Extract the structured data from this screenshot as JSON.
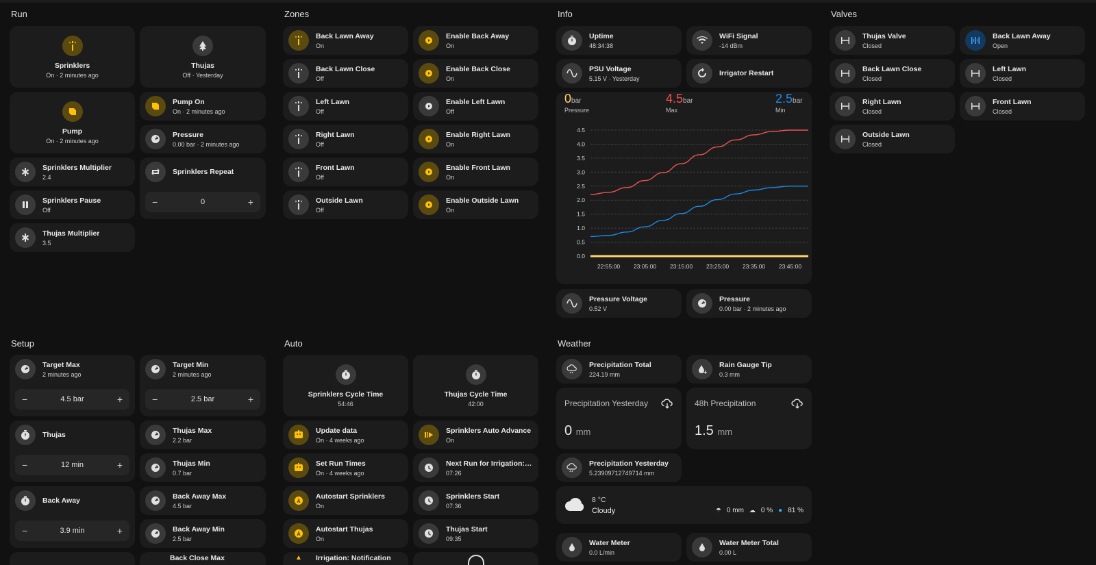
{
  "sections": {
    "run": "Run",
    "zones": "Zones",
    "info": "Info",
    "valves": "Valves",
    "setup": "Setup",
    "auto": "Auto",
    "weather": "Weather"
  },
  "run": {
    "sprinklers": {
      "name": "Sprinklers",
      "state": "On · 2 minutes ago"
    },
    "thujas": {
      "name": "Thujas",
      "state": "Off · Yesterday"
    },
    "pump": {
      "name": "Pump",
      "state": "On · 2 minutes ago"
    },
    "pump_on": {
      "name": "Pump On",
      "state": "On · 2 minutes ago"
    },
    "pressure": {
      "name": "Pressure",
      "state": "0.00 bar · 2 minutes ago"
    },
    "sprinklers_multiplier": {
      "name": "Sprinklers Multiplier",
      "state": "2.4"
    },
    "sprinklers_repeat": {
      "name": "Sprinklers Repeat",
      "value": "0",
      "minus": "−",
      "plus": "+"
    },
    "sprinklers_pause": {
      "name": "Sprinklers Pause",
      "state": "Off"
    },
    "thujas_multiplier": {
      "name": "Thujas Multiplier",
      "state": "3.5"
    }
  },
  "zones": [
    {
      "name": "Back Lawn Away",
      "state": "On",
      "enable": "Enable Back Away",
      "enable_state": "On"
    },
    {
      "name": "Back Lawn Close",
      "state": "Off",
      "enable": "Enable Back Close",
      "enable_state": "On"
    },
    {
      "name": "Left Lawn",
      "state": "Off",
      "enable": "Enable Left Lawn",
      "enable_state": "Off"
    },
    {
      "name": "Right Lawn",
      "state": "Off",
      "enable": "Enable Right Lawn",
      "enable_state": "On"
    },
    {
      "name": "Front Lawn",
      "state": "Off",
      "enable": "Enable Front Lawn",
      "enable_state": "On"
    },
    {
      "name": "Outside Lawn",
      "state": "Off",
      "enable": "Enable Outside Lawn",
      "enable_state": "On"
    }
  ],
  "info": {
    "uptime": {
      "name": "Uptime",
      "state": "48:34:38"
    },
    "wifi": {
      "name": "WiFi Signal",
      "state": "-14 dBm"
    },
    "psu": {
      "name": "PSU Voltage",
      "state": "5.15 V · Yesterday"
    },
    "restart": {
      "name": "Irrigator Restart"
    },
    "pressure_voltage": {
      "name": "Pressure Voltage",
      "state": "0.52 V"
    },
    "pressure": {
      "name": "Pressure",
      "state": "0.00 bar · 2 minutes ago"
    }
  },
  "chart_data": {
    "type": "line",
    "stats": [
      {
        "value": "0",
        "unit": "bar",
        "label": "Pressure",
        "color": "#ffd36b"
      },
      {
        "value": "4.5",
        "unit": "bar",
        "label": "Max",
        "color": "#ef5350"
      },
      {
        "value": "2.5",
        "unit": "bar",
        "label": "Min",
        "color": "#1e88e5"
      }
    ],
    "x": [
      "22:50:00",
      "22:55:00",
      "23:00:00",
      "23:05:00",
      "23:10:00",
      "23:15:00",
      "23:20:00",
      "23:25:00",
      "23:30:00",
      "23:35:00",
      "23:40:00",
      "23:45:00",
      "23:50:00"
    ],
    "x_ticks": [
      "22:55:00",
      "23:05:00",
      "23:15:00",
      "23:25:00",
      "23:35:00",
      "23:45:00"
    ],
    "y_ticks": [
      "0.0",
      "0.5",
      "1.0",
      "1.5",
      "2.0",
      "2.5",
      "3.0",
      "3.5",
      "4.0",
      "4.5"
    ],
    "ylim": [
      0,
      4.5
    ],
    "series": [
      {
        "name": "Max",
        "color": "#ef5350",
        "values": [
          2.2,
          2.28,
          2.45,
          2.7,
          2.98,
          3.3,
          3.62,
          3.9,
          4.15,
          4.33,
          4.45,
          4.5,
          4.5
        ]
      },
      {
        "name": "Min",
        "color": "#1e88e5",
        "values": [
          0.7,
          0.74,
          0.86,
          1.05,
          1.28,
          1.52,
          1.78,
          2.02,
          2.22,
          2.36,
          2.45,
          2.5,
          2.5
        ]
      },
      {
        "name": "Pressure",
        "color": "#ffd36b",
        "values": [
          0,
          0,
          0,
          0,
          0,
          0,
          0,
          0,
          0,
          0,
          0,
          0,
          0
        ]
      }
    ],
    "grid": true
  },
  "valves": [
    {
      "name": "Thujas Valve",
      "state": "Closed",
      "open": false
    },
    {
      "name": "Back Lawn Away",
      "state": "Open",
      "open": true
    },
    {
      "name": "Back Lawn Close",
      "state": "Closed",
      "open": false
    },
    {
      "name": "Left Lawn",
      "state": "Closed",
      "open": false
    },
    {
      "name": "Right Lawn",
      "state": "Closed",
      "open": false
    },
    {
      "name": "Front Lawn",
      "state": "Closed",
      "open": false
    },
    {
      "name": "Outside Lawn",
      "state": "Closed",
      "open": false
    }
  ],
  "setup": {
    "target_max": {
      "name": "Target Max",
      "state": "2 minutes ago",
      "value": "4.5 bar"
    },
    "target_min": {
      "name": "Target Min",
      "state": "2 minutes ago",
      "value": "2.5 bar"
    },
    "thujas": {
      "name": "Thujas",
      "value": "12 min"
    },
    "thujas_max": {
      "name": "Thujas Max",
      "state": "2.2 bar"
    },
    "thujas_min": {
      "name": "Thujas Min",
      "state": "0.7 bar"
    },
    "back_away": {
      "name": "Back Away",
      "value": "3.9 min"
    },
    "back_away_max": {
      "name": "Back Away Max",
      "state": "4.5 bar"
    },
    "back_away_min": {
      "name": "Back Away Min",
      "state": "2.5 bar"
    },
    "back_close_max": {
      "name": "Back Close Max"
    },
    "minus": "−",
    "plus": "+"
  },
  "auto": {
    "sprinklers_cycle": {
      "name": "Sprinklers Cycle Time",
      "state": "54:46"
    },
    "thujas_cycle": {
      "name": "Thujas Cycle Time",
      "state": "42:00"
    },
    "update_data": {
      "name": "Update data",
      "state": "On · 4 weeks ago"
    },
    "auto_advance": {
      "name": "Sprinklers Auto Advance",
      "state": "On"
    },
    "set_run_times": {
      "name": "Set Run Times",
      "state": "On · 4 weeks ago"
    },
    "next_run": {
      "name": "Next Run for Irrigation: Set...",
      "state": "07:26"
    },
    "autostart_sprinklers": {
      "name": "Autostart Sprinklers",
      "state": "On"
    },
    "sprinklers_start": {
      "name": "Sprinklers Start",
      "state": "07:36"
    },
    "autostart_thujas": {
      "name": "Autostart Thujas",
      "state": "On"
    },
    "thujas_start": {
      "name": "Thujas Start",
      "state": "09:35"
    },
    "irrigation_notification": {
      "name": "Irrigation: Notification"
    }
  },
  "weather": {
    "precip_total": {
      "name": "Precipitation Total",
      "state": "224.19 mm"
    },
    "rain_tip": {
      "name": "Rain Gauge Tip",
      "state": "0.3 mm"
    },
    "precip_yesterday_big": {
      "name": "Precipitation Yesterday",
      "value": "0",
      "unit": "mm"
    },
    "precip_48h": {
      "name": "48h Precipitation",
      "value": "1.5",
      "unit": "mm"
    },
    "precip_yesterday": {
      "name": "Precipitation Yesterday",
      "state": "5.23909712749714 mm"
    },
    "forecast": {
      "temp": "8 °C",
      "cond": "Cloudy",
      "rain": "0 mm",
      "prob": "0 %",
      "humidity": "81 %"
    },
    "water_meter": {
      "name": "Water Meter",
      "state": "0.0 L/min"
    },
    "water_meter_total": {
      "name": "Water Meter Total",
      "state": "0.00 L"
    }
  }
}
